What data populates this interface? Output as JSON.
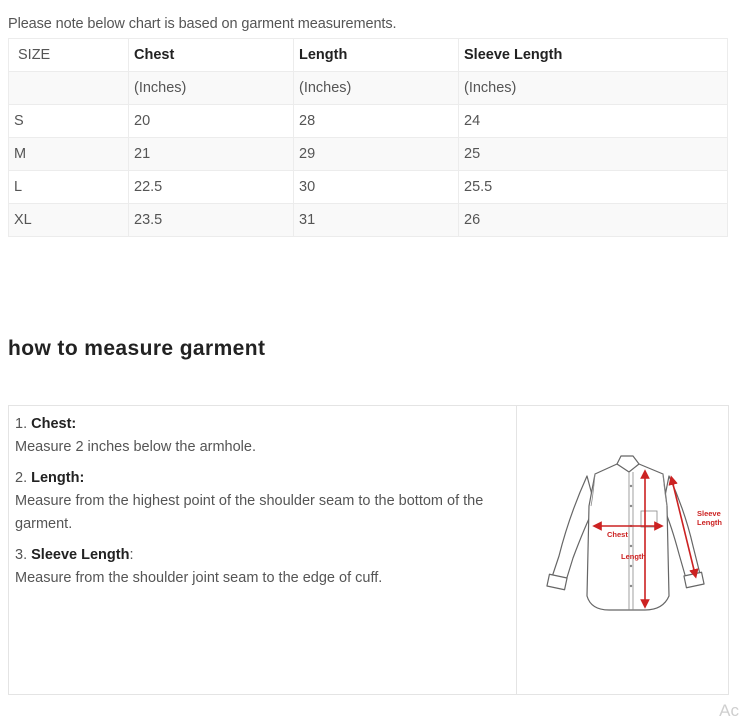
{
  "note": "Please note below chart is based on garment measurements.",
  "table": {
    "headers": [
      "SIZE",
      "Chest",
      "Length",
      "Sleeve Length"
    ],
    "units": [
      "",
      "(Inches)",
      "(Inches)",
      "(Inches)"
    ],
    "rows": [
      [
        "S",
        "20",
        "28",
        "24"
      ],
      [
        "M",
        "21",
        "29",
        "25"
      ],
      [
        "L",
        "22.5",
        "30",
        "25.5"
      ],
      [
        "XL",
        "23.5",
        "31",
        "26"
      ]
    ]
  },
  "howto": {
    "title": "how to measure garment",
    "items": [
      {
        "num": "1. ",
        "label": "Chest:",
        "suffix": "",
        "desc": "Measure 2 inches below the armhole."
      },
      {
        "num": "2. ",
        "label": "Length:",
        "suffix": "",
        "desc": "Measure from the highest point of the shoulder seam to the bottom of the garment."
      },
      {
        "num": "3. ",
        "label": "Sleeve Length",
        "suffix": ":",
        "desc": "Measure from the shoulder joint seam to the edge of cuff."
      }
    ],
    "diagram_labels": {
      "chest": "Chest",
      "length": "Length",
      "sleeve_line1": "Sleeve",
      "sleeve_line2": "Length"
    }
  },
  "corner_text": "Ac"
}
